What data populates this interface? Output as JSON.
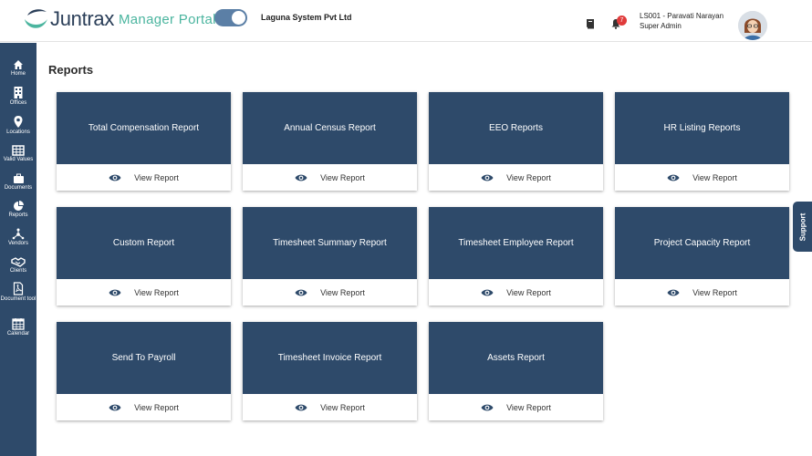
{
  "header": {
    "brand": "Juntrax",
    "portal": "Manager Portal",
    "company": "Laguna System Pvt Ltd",
    "notification_count": "7",
    "user_name": "LS001 - Paravati Narayan",
    "user_role": "Super Admin"
  },
  "sidebar": {
    "items": [
      {
        "label": "Home",
        "icon": "home-icon"
      },
      {
        "label": "Offices",
        "icon": "building-icon"
      },
      {
        "label": "Locations",
        "icon": "map-pin-icon"
      },
      {
        "label": "Valid Values",
        "icon": "table-icon"
      },
      {
        "label": "Documents",
        "icon": "briefcase-icon"
      },
      {
        "label": "Reports",
        "icon": "pie-chart-icon"
      },
      {
        "label": "Vendors",
        "icon": "network-icon"
      },
      {
        "label": "Clients",
        "icon": "handshake-icon"
      },
      {
        "label": "Document tool",
        "icon": "pdf-icon"
      },
      {
        "label": "Calendar",
        "icon": "calendar-icon"
      }
    ]
  },
  "page": {
    "title": "Reports"
  },
  "reports": [
    {
      "title": "Total Compensation Report",
      "action": "View Report"
    },
    {
      "title": "Annual Census Report",
      "action": "View Report"
    },
    {
      "title": "EEO Reports",
      "action": "View Report"
    },
    {
      "title": "HR Listing Reports",
      "action": "View Report"
    },
    {
      "title": "Custom Report",
      "action": "View Report"
    },
    {
      "title": "Timesheet Summary Report",
      "action": "View Report"
    },
    {
      "title": "Timesheet Employee Report",
      "action": "View Report"
    },
    {
      "title": "Project Capacity Report",
      "action": "View Report"
    },
    {
      "title": "Send To Payroll",
      "action": "View Report"
    },
    {
      "title": "Timesheet Invoice Report",
      "action": "View Report"
    },
    {
      "title": "Assets Report",
      "action": "View Report"
    }
  ],
  "support": {
    "label": "Support"
  },
  "colors": {
    "navy": "#2e4a6a",
    "teal": "#4bb59f",
    "badge": "#e03b3b"
  }
}
